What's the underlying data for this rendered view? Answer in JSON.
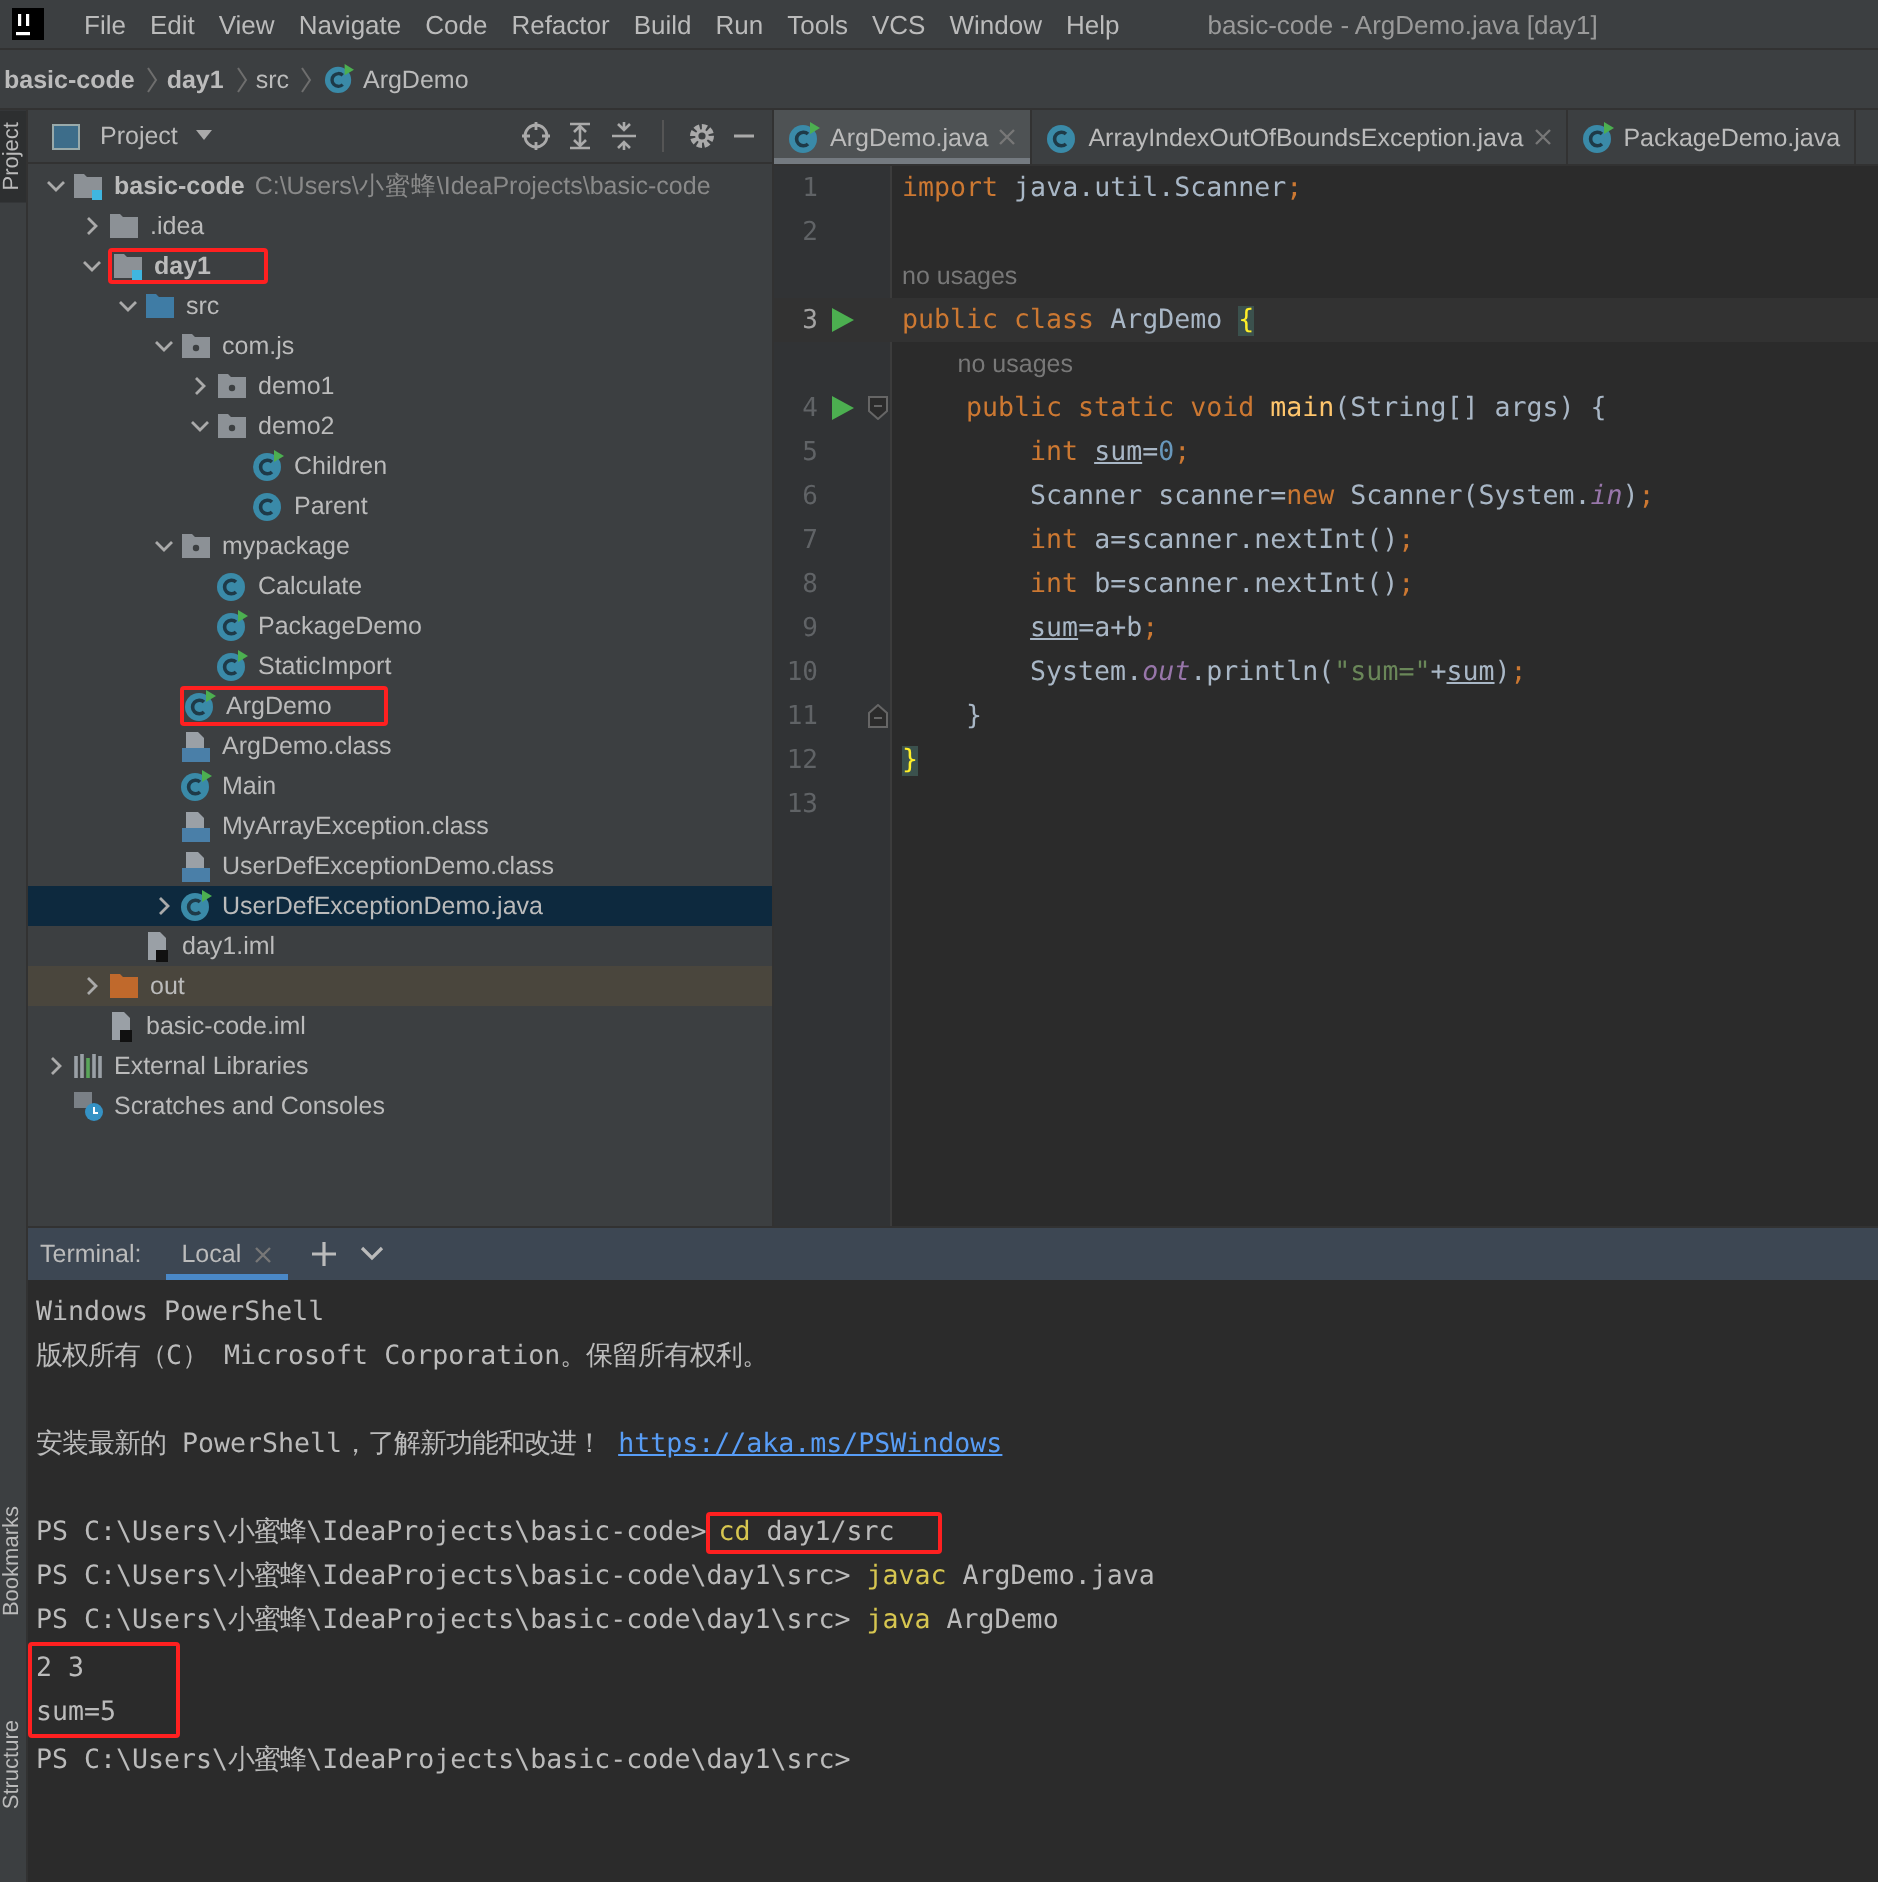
{
  "menu": {
    "items": [
      "File",
      "Edit",
      "View",
      "Navigate",
      "Code",
      "Refactor",
      "Build",
      "Run",
      "Tools",
      "VCS",
      "Window",
      "Help"
    ],
    "title": "basic-code - ArgDemo.java [day1]"
  },
  "breadcrumb": [
    {
      "label": "basic-code",
      "kind": "module"
    },
    {
      "label": "day1",
      "kind": "module"
    },
    {
      "label": "src",
      "kind": "folder"
    },
    {
      "label": "ArgDemo",
      "kind": "class"
    }
  ],
  "side_strip": {
    "top": [
      {
        "label": "Project",
        "selected": true
      }
    ],
    "bottom": [
      {
        "label": "Bookmarks",
        "selected": false
      },
      {
        "label": "Structure",
        "selected": false
      }
    ]
  },
  "project": {
    "title": "Project",
    "tree": [
      {
        "label": "basic-code",
        "path": "C:\\Users\\小蜜蜂\\IdeaProjects\\basic-code",
        "kind": "module",
        "expanded": true,
        "selected": false,
        "annotated": false,
        "children": [
          {
            "label": ".idea",
            "kind": "folder",
            "expanded": false,
            "selected": false,
            "annotated": false
          },
          {
            "label": "day1",
            "kind": "module",
            "expanded": true,
            "selected": false,
            "annotated": true,
            "children": [
              {
                "label": "src",
                "kind": "source",
                "expanded": true,
                "selected": false,
                "annotated": false,
                "children": [
                  {
                    "label": "com.js",
                    "kind": "package",
                    "expanded": true,
                    "selected": false,
                    "annotated": false,
                    "children": [
                      {
                        "label": "demo1",
                        "kind": "package",
                        "expanded": false,
                        "selected": false,
                        "annotated": false
                      },
                      {
                        "label": "demo2",
                        "kind": "package",
                        "expanded": true,
                        "selected": false,
                        "annotated": false,
                        "children": [
                          {
                            "label": "Children",
                            "kind": "class",
                            "runnable": true,
                            "selected": false,
                            "annotated": false
                          },
                          {
                            "label": "Parent",
                            "kind": "class",
                            "runnable": false,
                            "selected": false,
                            "annotated": false
                          }
                        ]
                      }
                    ]
                  },
                  {
                    "label": "mypackage",
                    "kind": "package",
                    "expanded": true,
                    "selected": false,
                    "annotated": false,
                    "children": [
                      {
                        "label": "Calculate",
                        "kind": "class",
                        "runnable": false,
                        "selected": false,
                        "annotated": false
                      },
                      {
                        "label": "PackageDemo",
                        "kind": "class",
                        "runnable": true,
                        "selected": false,
                        "annotated": false
                      },
                      {
                        "label": "StaticImport",
                        "kind": "class",
                        "runnable": true,
                        "selected": false,
                        "annotated": false
                      }
                    ]
                  },
                  {
                    "label": "ArgDemo",
                    "kind": "class",
                    "runnable": true,
                    "selected": false,
                    "annotated": true
                  },
                  {
                    "label": "ArgDemo.class",
                    "kind": "class_file",
                    "selected": false,
                    "annotated": false
                  },
                  {
                    "label": "Main",
                    "kind": "class",
                    "runnable": true,
                    "selected": false,
                    "annotated": false
                  },
                  {
                    "label": "MyArrayException.class",
                    "kind": "class_file",
                    "selected": false,
                    "annotated": false
                  },
                  {
                    "label": "UserDefExceptionDemo.class",
                    "kind": "class_file",
                    "selected": false,
                    "annotated": false
                  },
                  {
                    "label": "UserDefExceptionDemo.java",
                    "kind": "class",
                    "runnable": true,
                    "expanded": false,
                    "selected": true,
                    "annotated": false
                  }
                ]
              },
              {
                "label": "day1.iml",
                "kind": "module_file",
                "selected": false,
                "annotated": false
              }
            ]
          },
          {
            "label": "out",
            "kind": "excluded",
            "expanded": false,
            "selected": false,
            "annotated": false
          },
          {
            "label": "basic-code.iml",
            "kind": "module_file",
            "selected": false,
            "annotated": false
          }
        ]
      },
      {
        "label": "External Libraries",
        "kind": "libraries",
        "expanded": false,
        "selected": false,
        "annotated": false
      },
      {
        "label": "Scratches and Consoles",
        "kind": "scratches",
        "selected": false,
        "annotated": false
      }
    ]
  },
  "editor": {
    "tabs": [
      {
        "label": "ArgDemo.java",
        "runnable": true,
        "selected": true,
        "closable": true
      },
      {
        "label": "ArrayIndexOutOfBoundsException.java",
        "runnable": false,
        "selected": false,
        "closable": true
      },
      {
        "label": "PackageDemo.java",
        "runnable": true,
        "selected": false,
        "closable": false
      }
    ],
    "lines": [
      {
        "number": "1",
        "run": false,
        "current": false,
        "fold_marker": false,
        "tokens": [
          {
            "text": "import",
            "kind": "keyword"
          },
          {
            "text": " java.util.Scanner",
            "kind": "plain"
          },
          {
            "text": ";",
            "kind": "semicolon"
          }
        ]
      },
      {
        "number": "2",
        "run": false,
        "current": false,
        "fold_marker": false
      },
      {
        "number": "3",
        "hint": "no usages",
        "run": true,
        "current": true,
        "fold_marker": false,
        "tokens": [
          {
            "text": "public class",
            "kind": "keyword"
          },
          {
            "text": " ArgDemo ",
            "kind": "plain"
          },
          {
            "text": "{",
            "kind": "brace"
          }
        ],
        "children": [
          {
            "number": "4",
            "hint": "no usages",
            "run": true,
            "current": false,
            "fold_marker": true,
            "tokens": [
              {
                "text": "public static void",
                "kind": "keyword"
              },
              {
                "text": " main",
                "kind": "method"
              },
              {
                "text": "(String[] args) {",
                "kind": "plain"
              }
            ],
            "children": [
              {
                "number": "5",
                "run": false,
                "current": false,
                "fold_marker": false,
                "tokens": [
                  {
                    "text": "int ",
                    "kind": "keyword"
                  },
                  {
                    "text": "sum",
                    "kind": "variable"
                  },
                  {
                    "text": "=",
                    "kind": "plain"
                  },
                  {
                    "text": "0",
                    "kind": "number"
                  },
                  {
                    "text": ";",
                    "kind": "semicolon"
                  }
                ]
              },
              {
                "number": "6",
                "run": false,
                "current": false,
                "fold_marker": false,
                "tokens": [
                  {
                    "text": "Scanner scanner=",
                    "kind": "plain"
                  },
                  {
                    "text": "new",
                    "kind": "keyword"
                  },
                  {
                    "text": " Scanner(System.",
                    "kind": "plain"
                  },
                  {
                    "text": "in",
                    "kind": "field"
                  },
                  {
                    "text": ")",
                    "kind": "plain"
                  },
                  {
                    "text": ";",
                    "kind": "semicolon"
                  }
                ]
              },
              {
                "number": "7",
                "run": false,
                "current": false,
                "fold_marker": false,
                "tokens": [
                  {
                    "text": "int",
                    "kind": "keyword"
                  },
                  {
                    "text": " a=scanner.nextInt()",
                    "kind": "plain"
                  },
                  {
                    "text": ";",
                    "kind": "semicolon"
                  }
                ]
              },
              {
                "number": "8",
                "run": false,
                "current": false,
                "fold_marker": false,
                "tokens": [
                  {
                    "text": "int",
                    "kind": "keyword"
                  },
                  {
                    "text": " b=scanner.nextInt()",
                    "kind": "plain"
                  },
                  {
                    "text": ";",
                    "kind": "semicolon"
                  }
                ]
              },
              {
                "number": "9",
                "run": false,
                "current": false,
                "fold_marker": false,
                "tokens": [
                  {
                    "text": "sum",
                    "kind": "variable"
                  },
                  {
                    "text": "=a+b",
                    "kind": "plain"
                  },
                  {
                    "text": ";",
                    "kind": "semicolon"
                  }
                ]
              },
              {
                "number": "10",
                "run": false,
                "current": false,
                "fold_marker": false,
                "tokens": [
                  {
                    "text": "System.",
                    "kind": "plain"
                  },
                  {
                    "text": "out",
                    "kind": "field"
                  },
                  {
                    "text": ".println(",
                    "kind": "plain"
                  },
                  {
                    "text": "\"sum=\"",
                    "kind": "string"
                  },
                  {
                    "text": "+",
                    "kind": "plain"
                  },
                  {
                    "text": "sum",
                    "kind": "variable"
                  },
                  {
                    "text": ")",
                    "kind": "plain"
                  },
                  {
                    "text": ";",
                    "kind": "semicolon"
                  }
                ]
              }
            ]
          },
          {
            "number": "11",
            "run": false,
            "current": false,
            "fold_marker": true,
            "tokens": [
              {
                "text": "}",
                "kind": "plain"
              }
            ]
          }
        ]
      },
      {
        "number": "12",
        "run": false,
        "current": false,
        "fold_marker": false,
        "tokens": [
          {
            "text": "}",
            "kind": "brace"
          }
        ]
      },
      {
        "number": "13",
        "run": false,
        "current": false,
        "fold_marker": false
      }
    ]
  },
  "terminal": {
    "title": "Terminal:",
    "tabs": [
      {
        "label": "Local",
        "selected": true
      }
    ],
    "entries": [
      {
        "kind": "line",
        "segments": [
          {
            "text": "Windows PowerShell",
            "kind": "plain"
          }
        ]
      },
      {
        "kind": "line",
        "segments": [
          {
            "text": "版权所有（C） Microsoft Corporation。保留所有权利。",
            "kind": "plain"
          }
        ]
      },
      {
        "kind": "blank"
      },
      {
        "kind": "line",
        "segments": [
          {
            "text": "安装最新的 PowerShell，了解新功能和改进！",
            "kind": "plain"
          },
          {
            "text": "https://aka.ms/PSWindows",
            "kind": "link"
          }
        ]
      },
      {
        "kind": "blank"
      },
      {
        "kind": "line",
        "segments": [
          {
            "text": "PS C:\\Users\\小蜜蜂\\IdeaProjects\\basic-code>",
            "kind": "prompt"
          }
        ],
        "annotated_segments": [
          {
            "text": "cd",
            "kind": "command"
          },
          {
            "text": "day1/src",
            "kind": "plain"
          }
        ]
      },
      {
        "kind": "line",
        "segments": [
          {
            "text": "PS C:\\Users\\小蜜蜂\\IdeaProjects\\basic-code\\day1\\src>",
            "kind": "prompt"
          },
          {
            "text": "javac",
            "kind": "command"
          },
          {
            "text": "ArgDemo.java",
            "kind": "plain"
          }
        ]
      },
      {
        "kind": "line",
        "segments": [
          {
            "text": "PS C:\\Users\\小蜜蜂\\IdeaProjects\\basic-code\\day1\\src>",
            "kind": "prompt"
          },
          {
            "text": "java",
            "kind": "command"
          },
          {
            "text": "ArgDemo",
            "kind": "plain"
          }
        ]
      },
      {
        "kind": "group",
        "annotated": true,
        "lines": [
          "2 3",
          "sum=5"
        ]
      },
      {
        "kind": "line",
        "segments": [
          {
            "text": "PS C:\\Users\\小蜜蜂\\IdeaProjects\\basic-code\\day1\\src>",
            "kind": "prompt"
          }
        ]
      }
    ]
  }
}
